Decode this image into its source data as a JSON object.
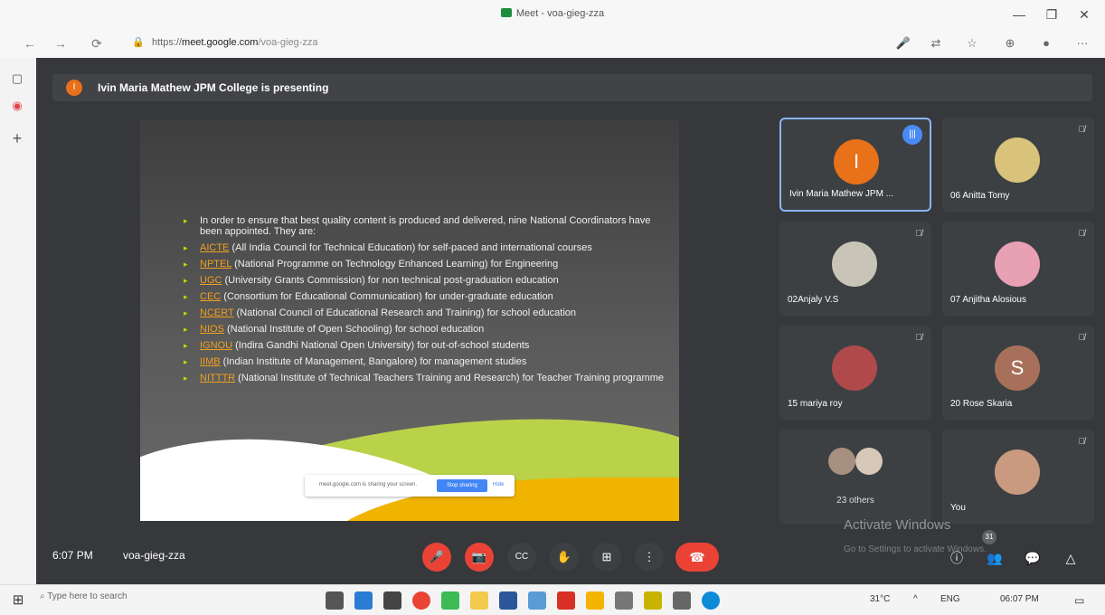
{
  "window": {
    "title": "Meet - voa-gieg-zza",
    "controls": {
      "minimize": "—",
      "maximize": "❐",
      "close": "✕"
    }
  },
  "browser": {
    "url_domain": "meet.google.com",
    "url_prefix": "https://",
    "url_path": "/voa-gieg-zza",
    "back": "←",
    "forward": "→",
    "reload": "⟳",
    "lock": "🔒",
    "toolbar_icons": {
      "mic": "🎤",
      "translate": "⇄",
      "favorites": "☆",
      "collections": "⊕",
      "profile": "●",
      "more": "···"
    }
  },
  "sidebar": {
    "tabs": "▢",
    "record": "◉",
    "add": "+"
  },
  "presenting_bar": {
    "avatar_letter": "I",
    "text": "Ivin Maria Mathew JPM College is presenting"
  },
  "slide": {
    "bullets": [
      {
        "abbr": "",
        "text": "In order to ensure that best quality content is produced and delivered, nine National Coordinators have been appointed. They are:"
      },
      {
        "abbr": "AICTE",
        "text": " (All India Council for Technical Education) for self-paced and international courses"
      },
      {
        "abbr": "NPTEL",
        "text": " (National Programme on Technology Enhanced Learning) for Engineering"
      },
      {
        "abbr": "UGC",
        "text": " (University Grants Commission) for non technical post-graduation education"
      },
      {
        "abbr": "CEC",
        "text": " (Consortium for Educational Communication) for under-graduate education"
      },
      {
        "abbr": "NCERT",
        "text": " (National Council of Educational Research and Training) for school education"
      },
      {
        "abbr": "NIOS",
        "text": " (National Institute of Open Schooling) for school education"
      },
      {
        "abbr": "IGNOU",
        "text": " (Indira Gandhi National Open University) for out-of-school students"
      },
      {
        "abbr": "IIMB",
        "text": " (Indian Institute of Management, Bangalore) for management studies"
      },
      {
        "abbr": "NITTTR",
        "text": " (National Institute of Technical Teachers Training and Research) for Teacher Training programme"
      }
    ],
    "share_notice": {
      "message": "meet.google.com is sharing your screen.",
      "stop_label": "Stop sharing",
      "hide_label": "Hide"
    }
  },
  "participants": [
    {
      "name": "Ivin Maria Mathew JPM ...",
      "letter": "I",
      "color": "#e8711a",
      "speaking": true
    },
    {
      "name": "06 Anitta Tomy",
      "letter": "",
      "color": "#d9c27a",
      "muted": true
    },
    {
      "name": "02Anjaly V.S",
      "letter": "",
      "color": "#c9c4b8",
      "muted": true
    },
    {
      "name": "07 Anjitha Alosious",
      "letter": "",
      "color": "#e8a0b4",
      "muted": true
    },
    {
      "name": "15 mariya roy",
      "letter": "",
      "color": "#b04a4a",
      "muted": true
    },
    {
      "name": "20 Rose Skaria",
      "letter": "S",
      "color": "#a8705a",
      "muted": true
    },
    {
      "name": "23 others",
      "letter": "",
      "color": "#a89080",
      "muted": false
    },
    {
      "name": "You",
      "letter": "",
      "color": "#c99a80",
      "muted": true
    }
  ],
  "bottom_bar": {
    "time": "6:07 PM",
    "meeting_code": "voa-gieg-zza",
    "people_count": "31",
    "controls": {
      "mic": "🎤",
      "camera": "📷",
      "captions": "CC",
      "raise_hand": "✋",
      "present": "⊞",
      "more": "⋮",
      "end_call": "☎"
    },
    "right_icons": {
      "info": "ⓘ",
      "people": "👥",
      "chat": "💬",
      "activities": "△"
    }
  },
  "activate_windows": {
    "title": "Activate Windows",
    "subtitle": "Go to Settings to activate Windows."
  },
  "taskbar": {
    "start": "⊞",
    "search_placeholder": "Type here to search",
    "weather": "31°C",
    "language": "ENG",
    "clock": "06:07 PM",
    "apps": [
      "task-view",
      "mail",
      "store",
      "chrome",
      "edge-beta",
      "files",
      "word",
      "teams",
      "acrobat",
      "powerpoint",
      "camera",
      "paint",
      "calculator",
      "edge"
    ]
  }
}
